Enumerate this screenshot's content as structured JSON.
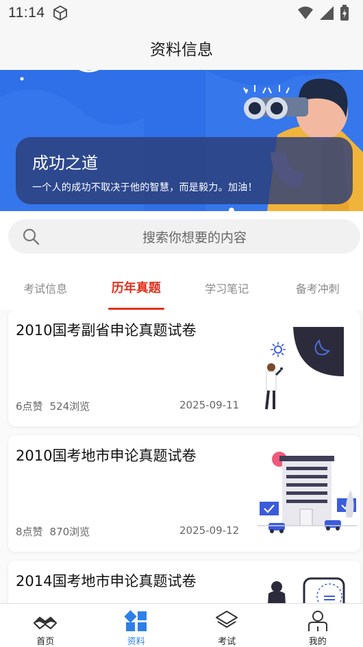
{
  "status": {
    "time": "11:14"
  },
  "header": {
    "title": "资料信息"
  },
  "banner": {
    "title": "成功之道",
    "subtitle": "一个人的成功不取决于他的智慧，而是毅力。加油！"
  },
  "search": {
    "placeholder": "搜索你想要的内容"
  },
  "tabs": [
    {
      "label": "考试信息",
      "active": false
    },
    {
      "label": "历年真题",
      "active": true
    },
    {
      "label": "学习笔记",
      "active": false
    },
    {
      "label": "备考冲刺",
      "active": false
    }
  ],
  "cards": [
    {
      "title": "2010国考副省申论真题试卷",
      "likes": "6点赞",
      "views": "524浏览",
      "date": "2025-09-11",
      "icon": "person-night-illustration"
    },
    {
      "title": "2010国考地市申论真题试卷",
      "likes": "8点赞",
      "views": "870浏览",
      "date": "2025-09-12",
      "icon": "building-check-illustration"
    },
    {
      "title": "2014国考地市申论真题试卷",
      "icon": "phone-person-illustration"
    }
  ],
  "nav": [
    {
      "label": "首页",
      "icon": "home-icon",
      "active": false
    },
    {
      "label": "资料",
      "icon": "grid-icon",
      "active": true
    },
    {
      "label": "考试",
      "icon": "layers-icon",
      "active": false
    },
    {
      "label": "我的",
      "icon": "person-icon",
      "active": false
    }
  ],
  "colors": {
    "accent": "#e0301e",
    "brand_blue": "#2f6fe7",
    "nav_active": "#2f7fe8"
  }
}
